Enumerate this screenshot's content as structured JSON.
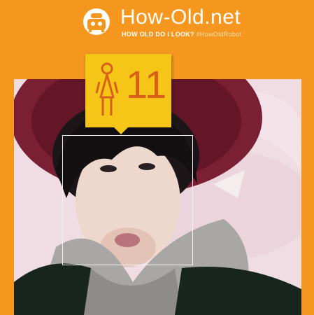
{
  "header": {
    "logo": "robot-logo-icon",
    "title": "How-Old.net",
    "tagline": "HOW OLD DO I LOOK?",
    "hashtag": "#HowOldRobot"
  },
  "result": {
    "gender_icon": "female-icon",
    "age": "11"
  },
  "colors": {
    "background": "#f5961e",
    "badge": "#f5c518",
    "badge_text": "#d9601a",
    "face_box": "#f4f4f4"
  }
}
